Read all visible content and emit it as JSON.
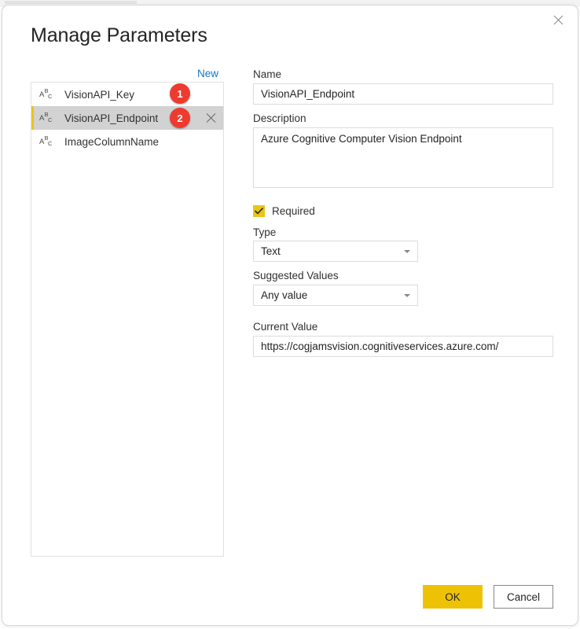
{
  "dialog": {
    "title": "Manage Parameters",
    "close_icon": "close-icon"
  },
  "left_panel": {
    "new_link": "New",
    "parameters": [
      {
        "name": "VisionAPI_Key",
        "type_icon": "abc-text-type-icon",
        "selected": false,
        "badge": "1"
      },
      {
        "name": "VisionAPI_Endpoint",
        "type_icon": "abc-text-type-icon",
        "selected": true,
        "badge": "2"
      },
      {
        "name": "ImageColumnName",
        "type_icon": "abc-text-type-icon",
        "selected": false,
        "badge": ""
      }
    ],
    "delete_icon": "close-icon"
  },
  "right_panel": {
    "name_label": "Name",
    "name_value": "VisionAPI_Endpoint",
    "description_label": "Description",
    "description_value": "Azure Cognitive Computer Vision Endpoint",
    "required_label": "Required",
    "required_checked": true,
    "type_label": "Type",
    "type_value": "Text",
    "suggested_values_label": "Suggested Values",
    "suggested_values_value": "Any value",
    "current_value_label": "Current Value",
    "current_value_value": "https://cogjamsvision.cognitiveservices.azure.com/"
  },
  "footer": {
    "ok_label": "OK",
    "cancel_label": "Cancel"
  },
  "colors": {
    "accent_yellow": "#eec204",
    "checkbox_yellow": "#e8c51c",
    "selected_row_bg": "#d2d2d2",
    "link_blue": "#1a75c4",
    "badge_red": "#ed3b2f"
  }
}
